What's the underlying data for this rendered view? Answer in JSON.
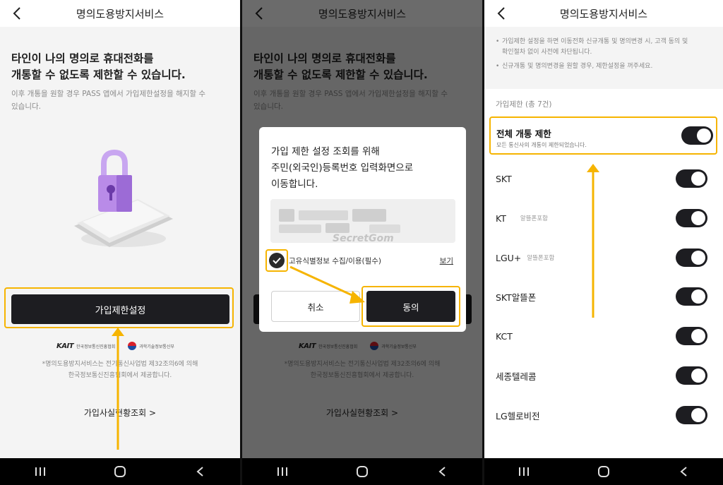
{
  "panel1": {
    "header_title": "명의도용방지서비스",
    "headline_line1": "타인이 나의 명의로 휴대전화를",
    "headline_line2": "개통할 수 없도록 제한할 수 있습니다.",
    "sub_line1": "이후 개통을 원할 경우 PASS 앱에서 가입제한설정을 해지할 수",
    "sub_line2": "있습니다.",
    "primary_button": "가입제한설정",
    "logo1_mark": "KAIT",
    "logo1_text": "한국정보통신진흥협회",
    "logo2_text": "과학기술정보통신부",
    "note_line1": "*명의도용방지서비스는 전기통신사업법 제32조의6에 의해",
    "note_line2": "한국정보통신진흥협회에서 제공합니다.",
    "link": "가입사실현황조회 >"
  },
  "panel2": {
    "modal_line1": "가입 제한 설정 조회를 위해",
    "modal_line2": "주민(외국인)등록번호 입력화면으로",
    "modal_line3": "이동합니다.",
    "watermark": "SecretGom",
    "consent_label": "고유식별정보 수집/이용(필수)",
    "view_link": "보기",
    "cancel_button": "취소",
    "agree_button": "동의"
  },
  "panel3": {
    "header_title": "명의도용방지서비스",
    "info1_line1": "가입제한 설정을 하면 이동전화 신규개통 및 명의변경 시, 고객 동의 및",
    "info1_line2": "확인절차 없이 사전에 차단됩니다.",
    "info2": "신규개통 및 명의변경을 원할 경우, 제한설정을 꺼주세요.",
    "section_label": "가입제한 (총 7건)",
    "all_block_title": "전체 개통 제한",
    "all_block_desc": "모든 통신사의 개통이 제한되었습니다.",
    "carriers": [
      {
        "name": "SKT",
        "badge": "",
        "on": true
      },
      {
        "name": "KT",
        "badge": "알뜰폰포함",
        "on": true
      },
      {
        "name": "LGU+",
        "badge": "알뜰폰포함",
        "on": true
      },
      {
        "name": "SKT알뜰폰",
        "badge": "",
        "on": true
      },
      {
        "name": "KCT",
        "badge": "",
        "on": true
      },
      {
        "name": "세종텔레콤",
        "badge": "",
        "on": true
      },
      {
        "name": "LG헬로비전",
        "badge": "",
        "on": true
      }
    ]
  },
  "colors": {
    "highlight": "#f6b400",
    "dark_button": "#1d1d21",
    "background": "#f4f4f4"
  }
}
